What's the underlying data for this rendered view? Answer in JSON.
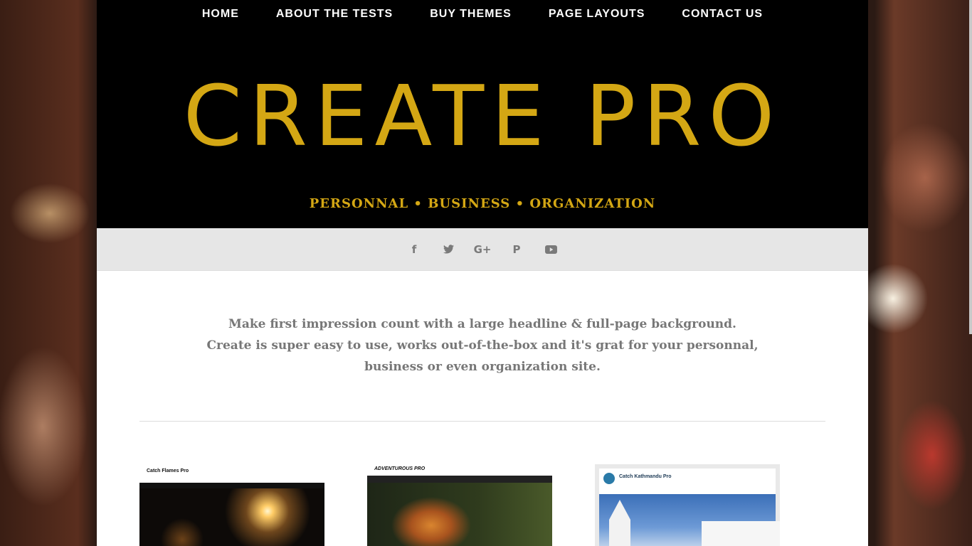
{
  "nav": {
    "items": [
      "HOME",
      "ABOUT THE TESTS",
      "BUY THEMES",
      "PAGE LAYOUTS",
      "CONTACT US"
    ]
  },
  "site": {
    "title": "CREATE PRO",
    "tagline": "PERSONNAL • BUSINESS • ORGANIZATION"
  },
  "social": {
    "icons": [
      "facebook-icon",
      "twitter-icon",
      "google-plus-icon",
      "pinterest-icon",
      "youtube-icon"
    ],
    "glyphs": [
      "f",
      "🐦",
      "G+",
      "P",
      "▶"
    ]
  },
  "intro": {
    "line1": "Make first impression count with a large headline & full-page background.",
    "line2": "Create is super easy to use, works out-of-the-box and it's grat for your personnal, business or even organization site."
  },
  "themes": [
    {
      "name": "Catch Flames Pro"
    },
    {
      "name": "ADVENTUROUS PRO"
    },
    {
      "name": "Catch Kathmandu Pro"
    }
  ],
  "colors": {
    "accent": "#d4a714",
    "header_bg": "#000000",
    "social_bar_bg": "#e6e6e6"
  }
}
